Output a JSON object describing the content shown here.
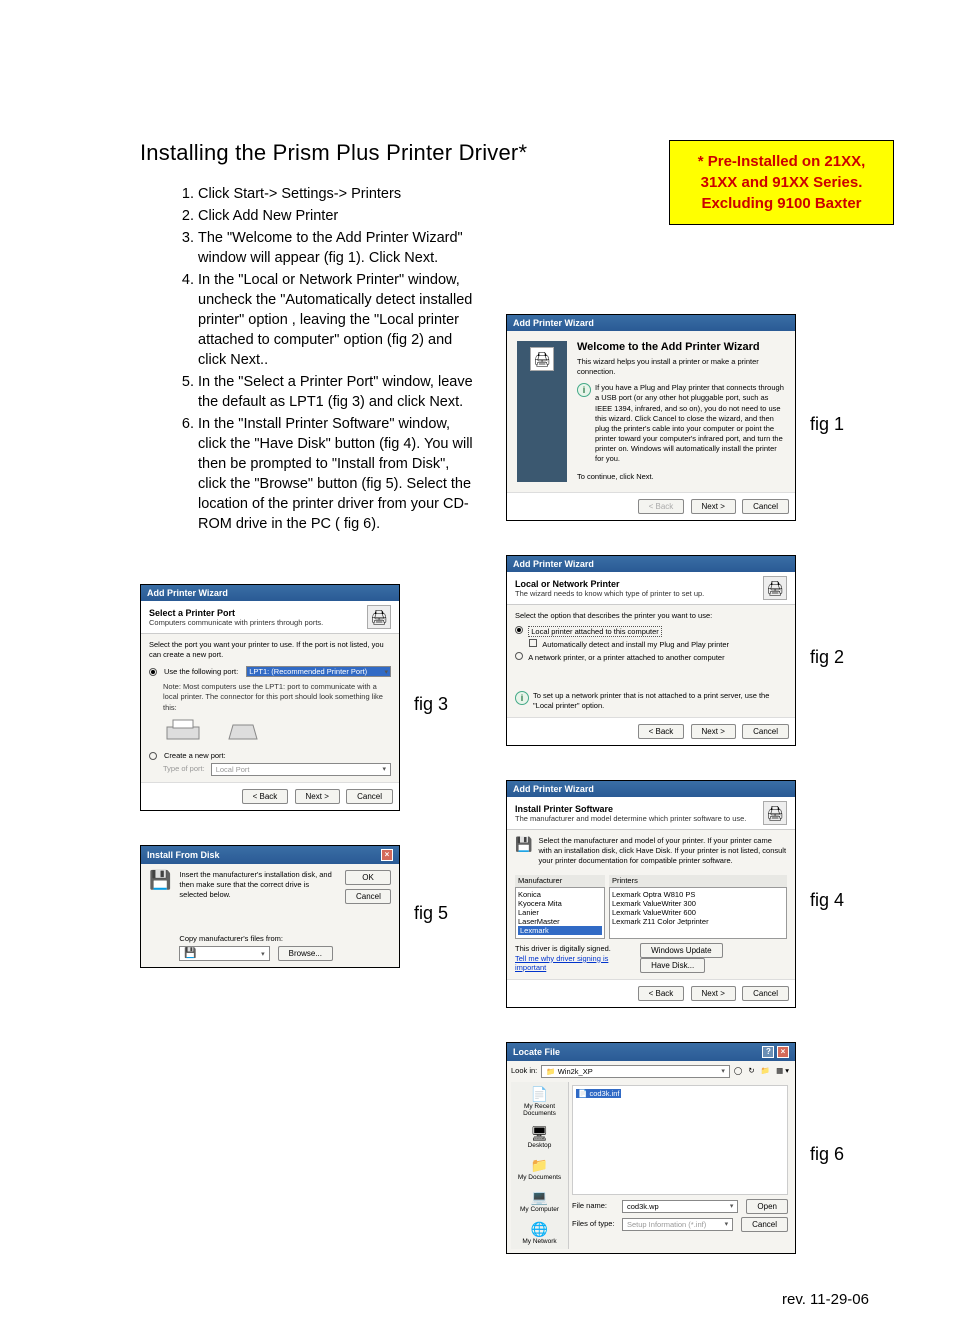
{
  "doc": {
    "title": "Installing the Prism Plus Printer Driver*",
    "callout": "* Pre-Installed on 21XX, 31XX and 91XX Series. Excluding 9100 Baxter",
    "rev": "rev. 11-29-06",
    "steps": [
      "Click Start-> Settings-> Printers",
      "Click Add New Printer",
      "The \"Welcome to the Add Printer Wizard\" window will appear (fig 1). Click Next.",
      "In the \"Local or Network Printer\" window, uncheck the \"Automatically detect installed printer\" option , leaving the \"Local printer attached to computer\" option (fig 2) and click Next..",
      "In the \"Select a Printer Port\" window, leave the default as LPT1 (fig 3) and click Next.",
      "In the \"Install Printer Software\" window, click the \"Have Disk\" button (fig 4).  You will then be prompted to \"Install from Disk\", click the \"Browse\" button (fig 5).  Select the location of the printer driver from your CD-ROM drive in the PC (   fig 6)."
    ],
    "labels": {
      "fig1": "fig 1",
      "fig2": "fig 2",
      "fig3": "fig 3",
      "fig4": "fig 4",
      "fig5": "fig 5",
      "fig6": "fig 6"
    }
  },
  "fig1": {
    "title": "Add Printer Wizard",
    "heading": "Welcome to the Add Printer Wizard",
    "intro": "This wizard helps you install a printer or make a printer connection.",
    "info": "If you have a Plug and Play printer that connects through a USB port (or any other hot pluggable port, such as IEEE 1394, infrared, and so on), you do not need to use this wizard. Click Cancel to close the wizard, and then plug the printer's cable into your computer or point the printer toward your computer's infrared port, and turn the printer on. Windows will automatically install the printer for you.",
    "continue": "To continue, click Next.",
    "btn_back": "< Back",
    "btn_next": "Next >",
    "btn_cancel": "Cancel"
  },
  "fig2": {
    "title": "Add Printer Wizard",
    "heading": "Local or Network Printer",
    "sub": "The wizard needs to know which type of printer to set up.",
    "prompt": "Select the option that describes the printer you want to use:",
    "opt_local": "Local printer attached to this computer",
    "chk_auto": "Automatically detect and install my Plug and Play printer",
    "opt_net": "A network printer, or a printer attached to another computer",
    "tip": "To set up a network printer that is not attached to a print server, use the \"Local printer\" option.",
    "btn_back": "< Back",
    "btn_next": "Next >",
    "btn_cancel": "Cancel"
  },
  "fig3": {
    "title": "Add Printer Wizard",
    "heading": "Select a Printer Port",
    "sub": "Computers communicate with printers through ports.",
    "prompt": "Select the port you want your printer to use.  If the port is not listed, you can create a new port.",
    "opt_use": "Use the following port:",
    "port_value": "LPT1: (Recommended Printer Port)",
    "note": "Note: Most computers use the LPT1: port to communicate with a local printer. The connector for this port should look something like this:",
    "opt_create": "Create a new port:",
    "type_label": "Type of port:",
    "type_value": "Local Port",
    "btn_back": "< Back",
    "btn_next": "Next >",
    "btn_cancel": "Cancel"
  },
  "fig4": {
    "title": "Add Printer Wizard",
    "heading": "Install Printer Software",
    "sub": "The manufacturer and model determine which printer software to use.",
    "prompt": "Select the manufacturer and model of your printer. If your printer came with an installation disk, click Have Disk. If your printer is not listed, consult your printer documentation for compatible printer software.",
    "col_manu": "Manufacturer",
    "col_prn": "Printers",
    "manu_list": [
      "Konica",
      "Kyocera Mita",
      "Lanier",
      "LaserMaster",
      "Lexmark"
    ],
    "prn_list": [
      "Lexmark Optra W810 PS",
      "Lexmark ValueWriter 300",
      "Lexmark ValueWriter 600",
      "Lexmark Z11 Color Jetprinter"
    ],
    "signed": "This driver is digitally signed.",
    "tell": "Tell me why driver signing is important",
    "btn_wu": "Windows Update",
    "btn_hd": "Have Disk...",
    "btn_back": "< Back",
    "btn_next": "Next >",
    "btn_cancel": "Cancel"
  },
  "fig5": {
    "title": "Install From Disk",
    "prompt": "Insert the manufacturer's installation disk, and then make sure that the correct drive is selected below.",
    "copy": "Copy manufacturer's files from:",
    "btn_ok": "OK",
    "btn_cancel": "Cancel",
    "btn_browse": "Browse..."
  },
  "fig6": {
    "title": "Locate File",
    "lookin_label": "Look in:",
    "lookin_value": "Win2k_XP",
    "file_item": "cod3k.inf",
    "places": [
      "My Recent Documents",
      "Desktop",
      "My Documents",
      "My Computer",
      "My Network"
    ],
    "filename_label": "File name:",
    "filename_value": "cod3k.wp",
    "type_label": "Files of type:",
    "type_value": "Setup Information (*.inf)",
    "btn_open": "Open",
    "btn_cancel": "Cancel"
  }
}
